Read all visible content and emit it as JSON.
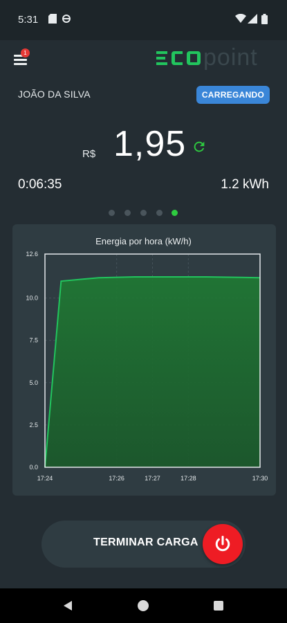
{
  "status_bar": {
    "time": "5:31",
    "icons": [
      "sd-card-icon",
      "sync-icon",
      "wifi-icon",
      "signal-icon",
      "battery-icon"
    ]
  },
  "app_bar": {
    "menu_badge": "1",
    "logo_text": "ECOpoint",
    "logo_colors": {
      "eco": "#22c55e",
      "point": "#3a474d"
    }
  },
  "session": {
    "user_name": "JOÃO DA SILVA",
    "status_label": "CARREGANDO",
    "currency": "R$",
    "price": "1,95",
    "elapsed": "0:06:35",
    "energy": "1.2 kWh"
  },
  "pager": {
    "count": 5,
    "active_index": 4
  },
  "chart_data": {
    "type": "area",
    "title": "Energia por hora (kW/h)",
    "x_tick_labels": [
      "17:24",
      "17:26",
      "17:27",
      "17:28",
      "17:30"
    ],
    "y_tick_labels": [
      "0.0",
      "2.5",
      "5.0",
      "7.5",
      "10.0",
      "12.6"
    ],
    "ylim": [
      0,
      12.6
    ],
    "xlim_minutes": [
      0,
      6
    ],
    "x_minutes": [
      0,
      0.45,
      1.5,
      2.5,
      3.5,
      4.5,
      5.5,
      6.0
    ],
    "values": [
      0,
      11.0,
      11.2,
      11.25,
      11.25,
      11.25,
      11.22,
      11.2
    ],
    "grid": true,
    "color": "#22c55e"
  },
  "actions": {
    "stop_label": "TERMINAR CARGA"
  },
  "colors": {
    "background": "#242d33",
    "card": "#2f3c42",
    "accent_green": "#2ecc40",
    "badge_blue": "#3a86d8",
    "stop_red": "#ee1c24"
  }
}
